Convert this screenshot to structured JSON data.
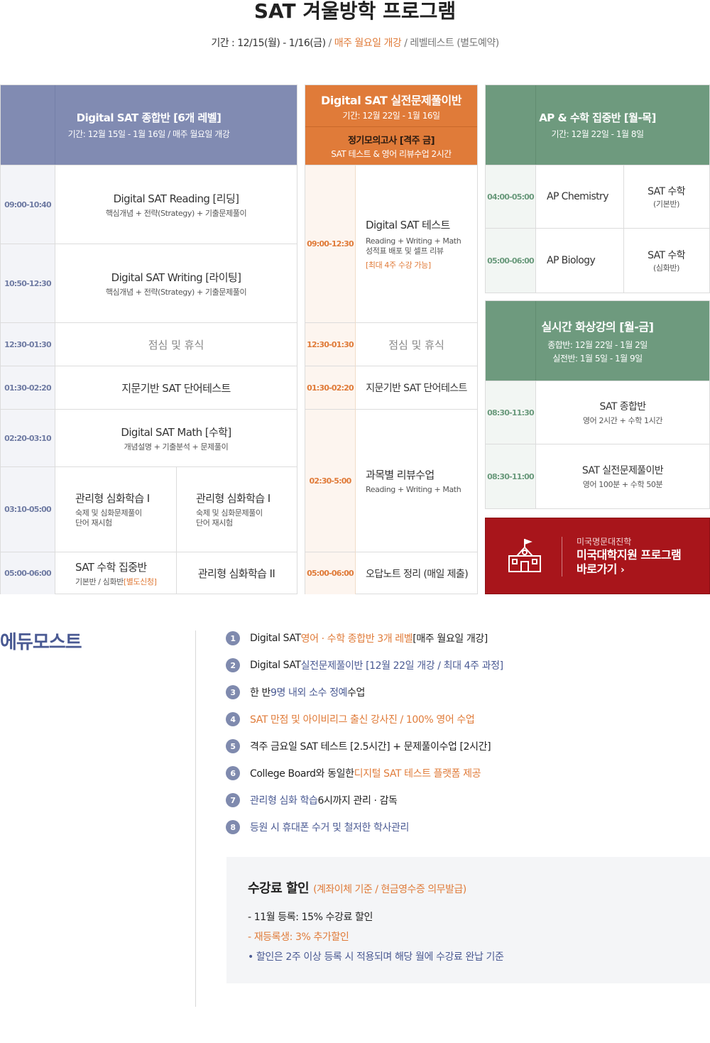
{
  "header": {
    "title": "SAT 겨울방학 프로그램",
    "period": "기간 : 12/15(월) - 1/16(금)",
    "sep1": " / ",
    "opening": "매주 월요일 개강",
    "sep2": " / ",
    "level_test": "레벨테스트 (별도예약)"
  },
  "panel1": {
    "title": "Digital SAT 종합반 [6개 레벨]",
    "sub": "기간: 12월 15일 - 1월 16일 / 매주 월요일 개강",
    "rows": [
      {
        "time": "09:00-10:40",
        "title": "Digital SAT Reading [리딩]",
        "sub": "핵심개념 + 전략(Strategy) + 기출문제풀이"
      },
      {
        "time": "10:50-12:30",
        "title": "Digital SAT Writing [라이팅]",
        "sub": "핵심개념 + 전략(Strategy) + 기출문제풀이"
      },
      {
        "time": "12:30-01:30",
        "title": "점심 및 휴식"
      },
      {
        "time": "01:30-02:20",
        "title": "지문기반 SAT 단어테스트"
      },
      {
        "time": "02:20-03:10",
        "title": "Digital SAT Math [수학]",
        "sub": "개념설명 + 기출분석 + 문제풀이"
      },
      {
        "time": "03:10-05:00",
        "left": {
          "title": "관리형 심화학습 I",
          "sub1": "숙제 및 심화문제풀이",
          "sub2": "단어 재시험"
        },
        "right": {
          "title": "관리형 심화학습 I",
          "sub1": "숙제 및 심화문제풀이",
          "sub2": "단어 재시험"
        }
      },
      {
        "time": "05:00-06:00",
        "left": {
          "title": "SAT 수학 집중반",
          "sub": "기본반 / 심화반",
          "note": "[별도신청]"
        },
        "right": {
          "title": "관리형 심화학습 II"
        }
      }
    ]
  },
  "panel2": {
    "title": "Digital SAT 실전문제풀이반",
    "sub": "기간: 12월 22일 - 1월 16일",
    "title2": "정기모의고사 [격주 금]",
    "sub2": "SAT 테스트 & 영어 리뷰수업 2시간",
    "rows": [
      {
        "time": "09:00-12:30",
        "title": "Digital SAT 테스트",
        "sub1": "Reading + Writing + Math",
        "sub2": "성적표 배포 및 셀프 리뷰",
        "note": "[최대 4주 수강 가능]"
      },
      {
        "time": "12:30-01:30",
        "title": "점심 및 휴식"
      },
      {
        "time": "01:30-02:20",
        "title": "지문기반 SAT 단어테스트"
      },
      {
        "time": "02:30-5:00",
        "title": "과목별 리뷰수업",
        "sub1": "Reading + Writing + Math"
      },
      {
        "time": "05:00-06:00",
        "title": "오답노트 정리 (매일 제출)"
      }
    ]
  },
  "panel3": {
    "title": "AP & 수학 집중반 [월-목]",
    "sub": "기간: 12월 22일 - 1월 8일",
    "rows": [
      {
        "time": "04:00-05:00",
        "title": "AP Chemistry",
        "right_title": "SAT 수학",
        "right_sub": "(기본반)"
      },
      {
        "time": "05:00-06:00",
        "title": "AP Biology",
        "right_title": "SAT 수학",
        "right_sub": "(심화반)"
      }
    ]
  },
  "panel4": {
    "title": "실시간 화상강의 [월-금]",
    "sub1": "종합반: 12월 22일 - 1월 2일",
    "sub2": "실전반: 1월 5일 - 1월 9일",
    "rows": [
      {
        "time": "08:30-11:30",
        "title": "SAT 종합반",
        "sub": "영어 2시간 + 수학 1시간"
      },
      {
        "time": "08:30-11:00",
        "title": "SAT 실전문제풀이반",
        "sub": "영어 100분 + 수학 50분"
      }
    ]
  },
  "promo": {
    "small": "미국명문대진학",
    "line1": "미국대학지원 프로그램",
    "line2": "바로가기",
    "arrow": "›",
    "icon": "school-building-icon"
  },
  "brand": "에듀모스트",
  "features": [
    {
      "num": "1",
      "a": "Digital SAT ",
      "b": "영어 · 수학 종합반 3개 레벨",
      "c": " [매주 월요일 개강]"
    },
    {
      "num": "2",
      "a": "Digital  SAT ",
      "b": "실전문제풀이반 [12월 22일 개강 / 최대 4주 과정]",
      "c": ""
    },
    {
      "num": "3",
      "a": "한 반 ",
      "b": "9명 내외 소수 정예",
      "c": " 수업"
    },
    {
      "num": "4",
      "a": "",
      "b": "SAT 만점 및 아이비리그 출신 강사진 / 100% 영어 수업",
      "c": ""
    },
    {
      "num": "5",
      "a": "격주 금요일 SAT 테스트 [2.5시간] + 문제풀이수업 [2시간]",
      "b": "",
      "c": ""
    },
    {
      "num": "6",
      "a": "College Board와 동일한 ",
      "b": "디지털 SAT 테스트 플랫폼 제공",
      "c": ""
    },
    {
      "num": "7",
      "a": "",
      "b": "관리형 심화 학습",
      "c": " 6시까지 관리 · 감독"
    },
    {
      "num": "8",
      "a": "",
      "b": "등원 시 휴대폰 수거 및 철저한 학사관리",
      "c": ""
    }
  ],
  "fee": {
    "title": "수강료 할인",
    "title_note": "(계좌이체 기준 / 현금영수증 의무발급)",
    "line1": "- 11월 등록: 15% 수강료 할인",
    "line2": "- 재등록생: 3% 추가할인",
    "line3": "• 할인은 2주 이상 등록 시 적용되며 해당 월에 수강료 완납 기준"
  },
  "colors": {
    "blue_header": "#818bb2",
    "orange_header": "#e07b39",
    "green_header": "#6e9a7e",
    "promo_red": "#a8151b",
    "brand": "#4a5a93"
  }
}
